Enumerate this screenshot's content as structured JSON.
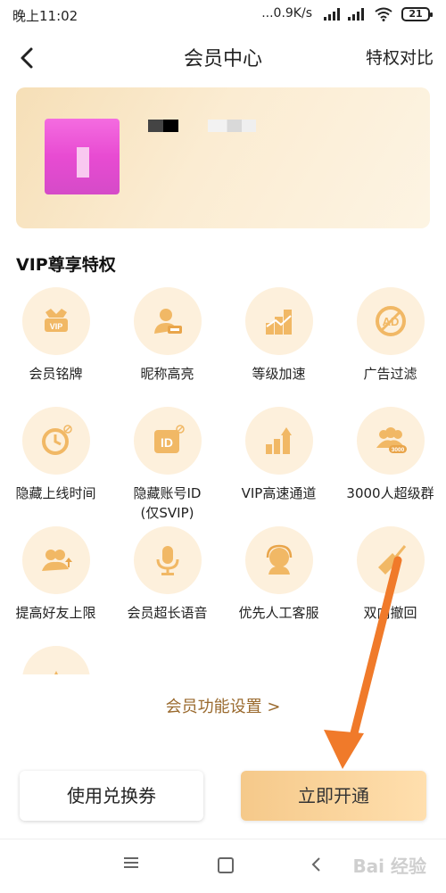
{
  "status_bar": {
    "time": "晚上11:02",
    "net_speed": "...0.9K/s",
    "battery": "21"
  },
  "header": {
    "title": "会员中心",
    "compare": "特权对比"
  },
  "section": {
    "title": "VIP尊享特权"
  },
  "features": [
    {
      "label": "会员铭牌",
      "icon": "vip-badge-icon"
    },
    {
      "label": "昵称高亮",
      "icon": "nickname-highlight-icon"
    },
    {
      "label": "等级加速",
      "icon": "level-boost-icon"
    },
    {
      "label": "广告过滤",
      "icon": "ad-filter-icon"
    },
    {
      "label": "隐藏上线时间",
      "icon": "hide-online-time-icon"
    },
    {
      "label": "隐藏账号ID",
      "label2": "(仅SVIP)",
      "icon": "hide-id-icon"
    },
    {
      "label": "VIP高速通道",
      "icon": "fast-channel-icon"
    },
    {
      "label": "3000人超级群",
      "icon": "super-group-icon"
    },
    {
      "label": "提高好友上限",
      "icon": "friend-limit-icon"
    },
    {
      "label": "会员超长语音",
      "icon": "long-voice-icon"
    },
    {
      "label": "优先人工客服",
      "icon": "customer-service-icon"
    },
    {
      "label": "双向撤回",
      "icon": "recall-icon"
    }
  ],
  "settings_link": "会员功能设置 >",
  "buttons": {
    "coupon": "使用兑换券",
    "open": "立即开通"
  },
  "watermark": "Bai 经验",
  "colors": {
    "accent": "#f5a86a",
    "icon": "#f1b865",
    "arrow": "#f07a2a"
  }
}
